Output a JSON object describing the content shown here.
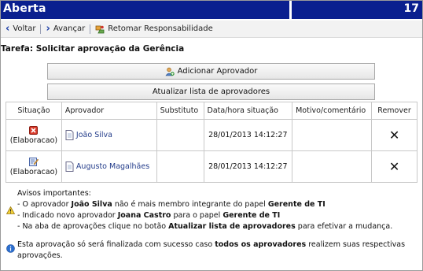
{
  "header": {
    "title": "Aberta",
    "number": "17",
    "bg_color": "#0a1f8f"
  },
  "toolbar": {
    "back_label": "Voltar",
    "forward_label": "Avançar",
    "resume_label": "Retomar Responsabilidade"
  },
  "task": {
    "title": "Tarefa: Solicitar aprovação da Gerência"
  },
  "buttons": {
    "add_approver": "Adicionar Aprovador",
    "update_list": "Atualizar lista de aprovadores"
  },
  "table": {
    "headers": {
      "situacao": "Situação",
      "aprovador": "Aprovador",
      "substituto": "Substituto",
      "data": "Data/hora situação",
      "motivo": "Motivo/comentário",
      "remover": "Remover"
    },
    "rows": [
      {
        "status_icon": "red-x-icon",
        "status": "(Elaboracao)",
        "approver": "João Silva",
        "substitute": "",
        "datetime": "28/01/2013 14:12:27",
        "reason": "",
        "remove_icon": "close-icon"
      },
      {
        "status_icon": "edit-form-icon",
        "status": "(Elaboracao)",
        "approver": "Augusto Magalhães",
        "substitute": "",
        "datetime": "28/01/2013 14:12:27",
        "reason": "",
        "remove_icon": "close-icon"
      }
    ]
  },
  "notices": {
    "heading": "Avisos importantes:",
    "l1_a": "- O aprovador ",
    "l1_b": "João Silva",
    "l1_c": " não é mais membro integrante do papel ",
    "l1_d": "Gerente de TI",
    "l2_a": "- Indicado novo aprovador ",
    "l2_b": "Joana Castro",
    "l2_c": " para o papel ",
    "l2_d": "Gerente de TI",
    "l3_a": "- Na aba de aprovações clique no botão ",
    "l3_b": "Atualizar lista de aprovadores",
    "l3_c": " para efetivar a mudança.",
    "i_a": "Esta aprovação só será finalizada com sucesso caso ",
    "i_b": "todos os aprovadores",
    "i_c": " realizem suas respectivas aprovações."
  }
}
